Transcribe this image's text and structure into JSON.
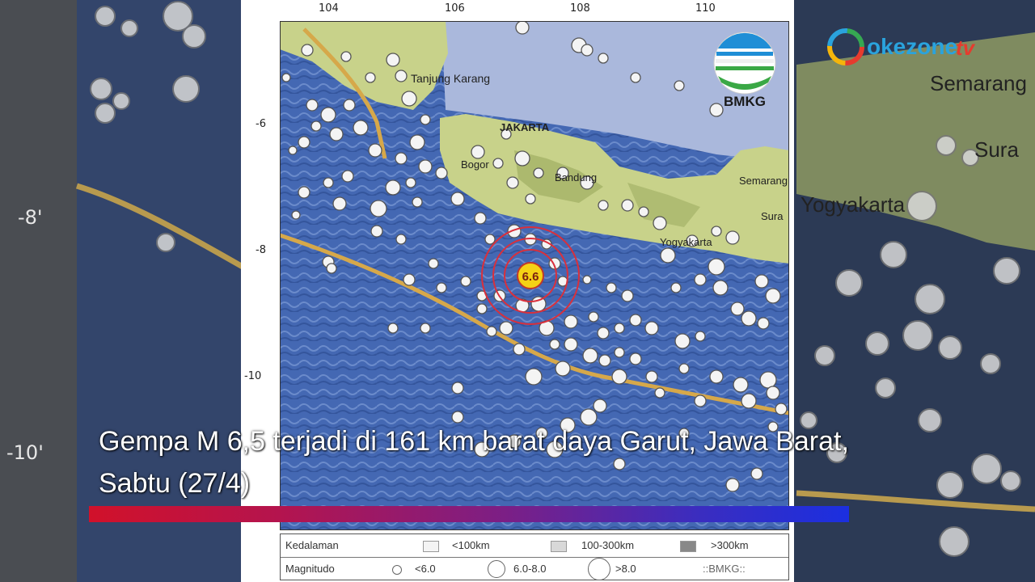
{
  "map": {
    "lon_ticks": [
      "104",
      "106",
      "108",
      "110"
    ],
    "lat_ticks": [
      "-6",
      "-8",
      "-10"
    ],
    "places": {
      "tanjung_karang": "Tanjung Karang",
      "jakarta": "JAKARTA",
      "bogor": "Bogor",
      "bandung": "Bandung",
      "semarang": "Semarang",
      "surabaya": "Sura",
      "yogyakarta": "Yogyakarta"
    },
    "epicenter_magnitude": "6.6",
    "logo_text": "BMKG",
    "colors": {
      "ocean": "#3f66b4",
      "land": "#c8d28a",
      "trench": "#d6a84a",
      "epicenter": "#f5d215",
      "rings": "#d9303c"
    }
  },
  "legend": {
    "depth_title": "Kedalaman",
    "depth_items": [
      "<100km",
      "100-300km",
      ">300km"
    ],
    "mag_title": "Magnitudo",
    "mag_items": [
      "<6.0",
      "6.0-8.0",
      ">8.0"
    ],
    "credit": "::BMKG::"
  },
  "background": {
    "lat_labels": [
      "-8'",
      "-10'"
    ],
    "places": {
      "semarang": "Semarang",
      "surabaya": "Sura",
      "yogyakarta": "Yogyakarta"
    }
  },
  "broadcaster": {
    "logo_text": "okezone",
    "suffix": "tv"
  },
  "caption": {
    "line1": "Gempa M 6,5 terjadi di 161 km barat daya Garut, Jawa Barat,",
    "line2": "Sabtu (27/4)"
  }
}
